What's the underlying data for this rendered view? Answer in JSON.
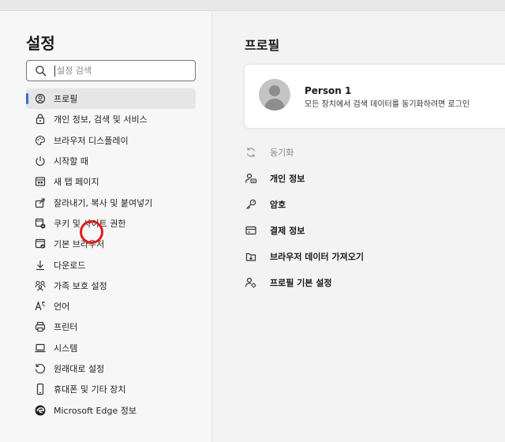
{
  "sidebar": {
    "title": "설정",
    "search": {
      "placeholder": "설정 검색",
      "value": ""
    },
    "items": [
      {
        "label": "프로필",
        "icon": "profile-icon",
        "active": true
      },
      {
        "label": "개인 정보, 검색 및 서비스",
        "icon": "lock-icon"
      },
      {
        "label": "브라우저 디스플레이",
        "icon": "palette-icon"
      },
      {
        "label": "시작할 때",
        "icon": "power-icon"
      },
      {
        "label": "새 탭 페이지",
        "icon": "new-tab-icon"
      },
      {
        "label": "잘라내기, 복사 및 붙여넣기",
        "icon": "share-icon"
      },
      {
        "label": "쿠키 및 사이트 권한",
        "icon": "cookie-site-icon"
      },
      {
        "label": "기본 브라우저",
        "icon": "default-browser-icon"
      },
      {
        "label": "다운로드",
        "icon": "download-icon"
      },
      {
        "label": "가족 보호 설정",
        "icon": "family-icon"
      },
      {
        "label": "언어",
        "icon": "language-icon"
      },
      {
        "label": "프린터",
        "icon": "printer-icon"
      },
      {
        "label": "시스템",
        "icon": "laptop-icon"
      },
      {
        "label": "원래대로 설정",
        "icon": "reset-icon"
      },
      {
        "label": "휴대폰 및 기타 장치",
        "icon": "phone-icon"
      },
      {
        "label": "Microsoft Edge 정보",
        "icon": "edge-logo-icon"
      }
    ]
  },
  "main": {
    "title": "프로필",
    "profile": {
      "name": "Person 1",
      "subtitle": "모든 장치에서 검색 데이터를 동기화하려면 로그인"
    },
    "settings": [
      {
        "label": "동기화",
        "icon": "sync-icon",
        "disabled": true
      },
      {
        "label": "개인 정보",
        "icon": "personal-info-icon"
      },
      {
        "label": "암호",
        "icon": "key-icon"
      },
      {
        "label": "결제 정보",
        "icon": "card-icon"
      },
      {
        "label": "브라우저 데이터 가져오기",
        "icon": "import-icon"
      },
      {
        "label": "프로필 기본 설정",
        "icon": "profile-settings-icon"
      }
    ]
  },
  "colors": {
    "accent": "#2f6fd6",
    "highlight": "#e21b1b"
  }
}
